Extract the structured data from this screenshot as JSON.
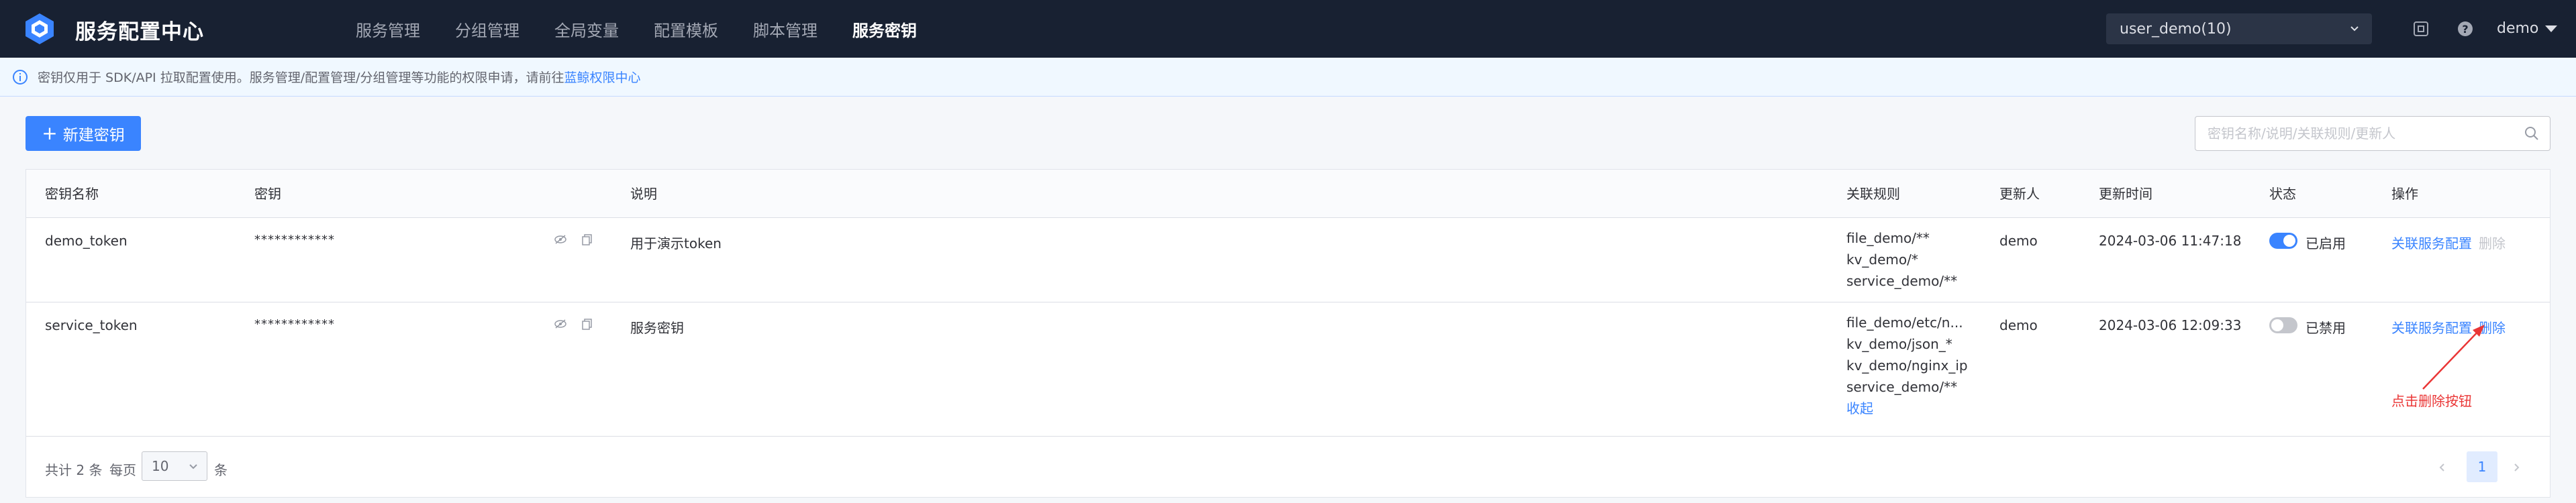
{
  "app": {
    "title": "服务配置中心"
  },
  "nav": {
    "items": [
      {
        "label": "服务管理"
      },
      {
        "label": "分组管理"
      },
      {
        "label": "全局变量"
      },
      {
        "label": "配置模板"
      },
      {
        "label": "脚本管理"
      },
      {
        "label": "服务密钥",
        "active": true
      }
    ]
  },
  "header": {
    "business_select": "user_demo(10)",
    "user": "demo",
    "icons": [
      "help-center-icon",
      "question-icon"
    ]
  },
  "notice": {
    "text": "密钥仅用于 SDK/API 拉取配置使用。服务管理/配置管理/分组管理等功能的权限申请，请前往",
    "link": "蓝鲸权限中心",
    "icon": "info-icon"
  },
  "toolbar": {
    "create_label": "新建密钥",
    "search_placeholder": "密钥名称/说明/关联规则/更新人"
  },
  "table": {
    "columns": [
      "密钥名称",
      "密钥",
      "说明",
      "关联规则",
      "更新人",
      "更新时间",
      "状态",
      "操作"
    ],
    "rows": [
      {
        "name": "demo_token",
        "key": "************",
        "desc": "用于演示token",
        "rules": [
          "file_demo/**",
          "kv_demo/*",
          "service_demo/**"
        ],
        "updater": "demo",
        "updated_at": "2024-03-06 11:47:18",
        "enabled": true,
        "status": "已启用",
        "action_link": "关联服务配置",
        "action_delete": "删除",
        "delete_disabled": true
      },
      {
        "name": "service_token",
        "key": "************",
        "desc": "服务密钥",
        "rules": [
          "file_demo/etc/n...",
          "kv_demo/json_*",
          "kv_demo/nginx_ip",
          "service_demo/**"
        ],
        "collapse": "收起",
        "updater": "demo",
        "updated_at": "2024-03-06 12:09:33",
        "enabled": false,
        "status": "已禁用",
        "action_link": "关联服务配置",
        "action_delete": "删除",
        "delete_disabled": false
      }
    ]
  },
  "annotation": {
    "text": "点击删除按钮",
    "color": "#ea3636"
  },
  "pagination": {
    "total": "共计 2 条",
    "per_page_label": "每页",
    "page_size": "10",
    "unit": "条",
    "current_page": "1"
  },
  "colors": {
    "primary": "#3a84ff",
    "nav_bg": "#182132",
    "danger": "#ea3636"
  }
}
